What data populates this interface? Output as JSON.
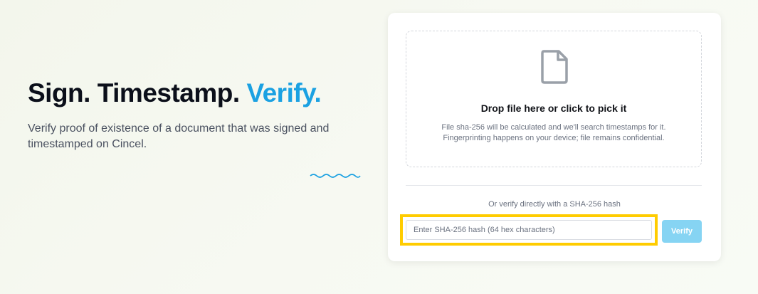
{
  "hero": {
    "title_part1": "Sign. Timestamp. ",
    "title_accent": "Verify.",
    "subtitle": "Verify proof of existence of a document that was signed and timestamped on Cincel."
  },
  "dropzone": {
    "icon": "file-icon",
    "title": "Drop file here or click to pick it",
    "desc_line1": "File sha-256 will be calculated and we'll search timestamps for it.",
    "desc_line2": "Fingerprinting happens on your device; file remains confidential."
  },
  "hash_section": {
    "or_text": "Or verify directly with a SHA-256 hash",
    "input_value": "",
    "input_placeholder": "Enter SHA-256 hash (64 hex characters)",
    "verify_label": "Verify"
  },
  "colors": {
    "accent": "#1ba1e2",
    "button": "#86d4f3",
    "highlight": "#ffcc00"
  }
}
